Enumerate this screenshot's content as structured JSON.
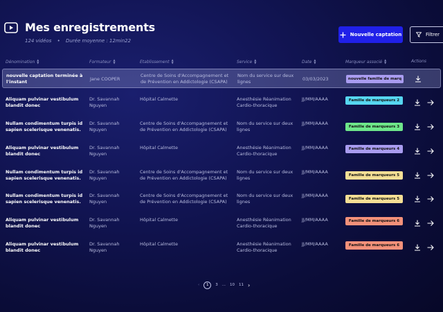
{
  "header": {
    "title": "Mes enregistrements",
    "count": "124 vidéos",
    "avg_duration": "Durée moyenne : 12min22",
    "new_button": "Nouvelle captation",
    "filter_button": "Filtrer"
  },
  "columns": {
    "name": "Dénomination",
    "trainer": "Formateur",
    "etab": "Etablissement",
    "service": "Service",
    "date": "Date",
    "marker": "Marqueur associé",
    "actions": "Actions"
  },
  "rows": [
    {
      "name": "nouvelle captation terminée à l'instant",
      "trainer": "Jane COOPER",
      "etab": "Centre de Soins d'Accompagnement et de Prévention en Addictologie (CSAPA)",
      "service": "Nom du service sur deux lignes",
      "date": "03/03/2023",
      "marker": "nouvelle famille de marq",
      "marker_color": "#a99cf0"
    },
    {
      "name": "Aliquam pulvinar vestibulum blandit donec",
      "trainer": "Dr. Savannah Nguyen",
      "etab": "Hôpital Calmette",
      "service": "Anesthésie Réanimation Cardio-thoracique",
      "date": "JJ/MM/AAAA",
      "marker": "Famille de marqueurs 2",
      "marker_color": "#56d6f0"
    },
    {
      "name": "Nullam condimentum turpis id sapien scelerisque venenatis.",
      "trainer": "Dr. Savannah Nguyen",
      "etab": "Centre de Soins d'Accompagnement et de Prévention en Addictologie (CSAPA)",
      "service": "Nom du service sur deux lignes",
      "date": "JJ/MM/AAAA",
      "marker": "Famille de marqueurs 3",
      "marker_color": "#6ee68a"
    },
    {
      "name": "Aliquam pulvinar vestibulum blandit donec",
      "trainer": "Dr. Savannah Nguyen",
      "etab": "Hôpital Calmette",
      "service": "Anesthésie Réanimation Cardio-thoracique",
      "date": "JJ/MM/AAAA",
      "marker": "Famille de marqueurs 4",
      "marker_color": "#a99cf0"
    },
    {
      "name": "Nullam condimentum turpis id sapien scelerisque venenatis.",
      "trainer": "Dr. Savannah Nguyen",
      "etab": "Centre de Soins d'Accompagnement et de Prévention en Addictologie (CSAPA)",
      "service": "Nom du service sur deux lignes",
      "date": "JJ/MM/AAAA",
      "marker": "Famille de marqueurs 5",
      "marker_color": "#f5df95"
    },
    {
      "name": "Nullam condimentum turpis id sapien scelerisque venenatis.",
      "trainer": "Dr. Savannah Nguyen",
      "etab": "Centre de Soins d'Accompagnement et de Prévention en Addictologie (CSAPA)",
      "service": "Nom du service sur deux lignes",
      "date": "JJ/MM/AAAA",
      "marker": "Famille de marqueurs 5",
      "marker_color": "#f5df95"
    },
    {
      "name": "Aliquam pulvinar vestibulum blandit donec",
      "trainer": "Dr. Savannah Nguyen",
      "etab": "Hôpital Calmette",
      "service": "Anesthésie Réanimation Cardio-thoracique",
      "date": "JJ/MM/AAAA",
      "marker": "Famille de marqueurs 6",
      "marker_color": "#f4917a"
    },
    {
      "name": "Aliquam pulvinar vestibulum blandit donec",
      "trainer": "Dr. Savannah Nguyen",
      "etab": "Hôpital Calmette",
      "service": "Anesthésie Réanimation Cardio-thoracique",
      "date": "JJ/MM/AAAA",
      "marker": "Famille de marqueurs 6",
      "marker_color": "#f4917a"
    }
  ],
  "pagination": {
    "current": "1",
    "p2": "3",
    "ellipsis": "...",
    "p3": "10",
    "p4": "11"
  },
  "icons": {
    "title": "video-play-icon",
    "new": "plus-icon",
    "filter": "filter-icon",
    "download": "download-icon",
    "open": "arrow-right-icon"
  }
}
